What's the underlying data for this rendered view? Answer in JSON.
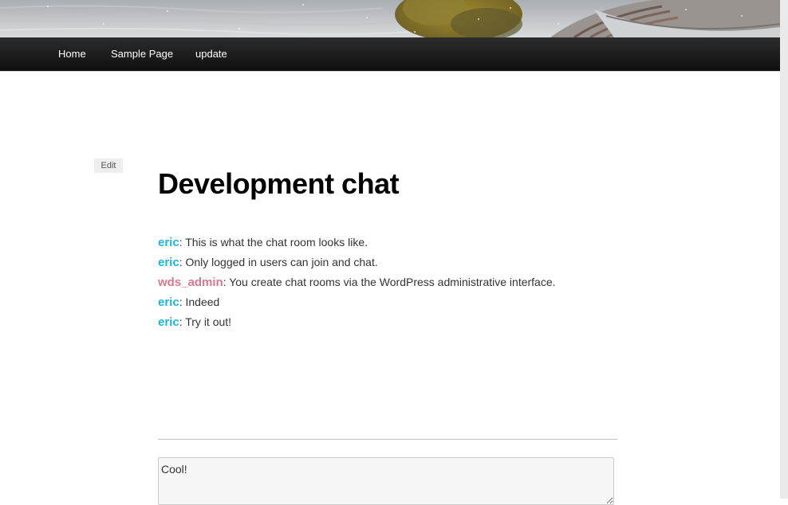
{
  "header": {
    "image_icon": "header-photo"
  },
  "nav": {
    "items": [
      {
        "label": "Home"
      },
      {
        "label": "Sample Page"
      },
      {
        "label": "update"
      }
    ]
  },
  "post": {
    "edit_label": "Edit",
    "title": "Development chat"
  },
  "chat": {
    "messages": [
      {
        "user": "eric",
        "separator": ":",
        "text": " This is what the chat room looks like.",
        "color": "#1bb7dc"
      },
      {
        "user": "eric",
        "separator": ":",
        "text": " Only logged in users can join and chat.",
        "color": "#1bb7dc"
      },
      {
        "user": "wds_admin",
        "separator": ":",
        "text": " You create chat rooms via the WordPress administrative interface.",
        "color": "#d77a8c"
      },
      {
        "user": "eric",
        "separator": ":",
        "text": " Indeed",
        "color": "#1bb7dc"
      },
      {
        "user": "eric",
        "separator": ":",
        "text": " Try it out!",
        "color": "#1bb7dc"
      }
    ],
    "input_value": "Cool!"
  }
}
